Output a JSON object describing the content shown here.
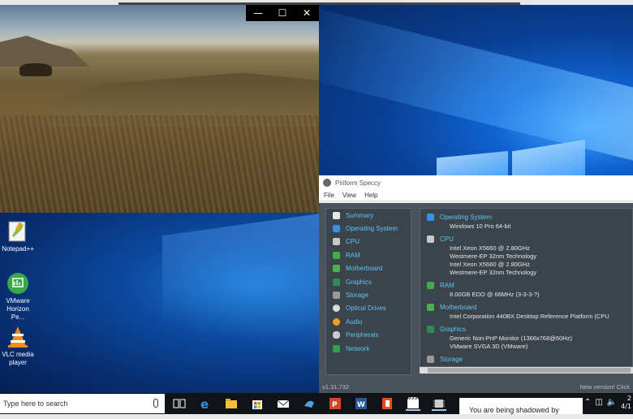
{
  "movie_window": {
    "controls": {
      "minimize": "—",
      "maximize": "☐",
      "close": "✕"
    }
  },
  "desktop_icons": [
    {
      "label": "Notepad++",
      "icon": "notepad-plus-plus-icon"
    },
    {
      "label": "VMware Horizon Pe...",
      "icon": "vmware-horizon-icon"
    },
    {
      "label": "VLC media player",
      "icon": "vlc-icon"
    }
  ],
  "speccy": {
    "title": "Piriform Speccy",
    "menu": [
      "File",
      "View",
      "Help"
    ],
    "nav": [
      {
        "label": "Summary",
        "color": "#e8e8e8"
      },
      {
        "label": "Operating System",
        "color": "#3b8fe0"
      },
      {
        "label": "CPU",
        "color": "#c9c9c9"
      },
      {
        "label": "RAM",
        "color": "#3fae49"
      },
      {
        "label": "Motherboard",
        "color": "#4caf50"
      },
      {
        "label": "Graphics",
        "color": "#2e8b57"
      },
      {
        "label": "Storage",
        "color": "#999999"
      },
      {
        "label": "Optical Drives",
        "color": "#d9d9d9"
      },
      {
        "label": "Audio",
        "color": "#f0a020"
      },
      {
        "label": "Peripherals",
        "color": "#cccccc"
      },
      {
        "label": "Network",
        "color": "#2fa34b"
      }
    ],
    "sections": [
      {
        "title": "Operating System",
        "color": "#3b8fe0",
        "lines": [
          "Windows 10 Pro 64-bit"
        ]
      },
      {
        "title": "CPU",
        "color": "#c9c9c9",
        "lines": [
          "Intel Xeon X5660 @ 2.80GHz",
          "Westmere-EP 32nm Technology",
          "Intel Xeon X5660 @ 2.80GHz",
          "Westmere-EP 32nm Technology"
        ]
      },
      {
        "title": "RAM",
        "color": "#3fae49",
        "lines": [
          "8.00GB EDO @ 66MHz (3-3-3-?)"
        ]
      },
      {
        "title": "Motherboard",
        "color": "#4caf50",
        "lines": [
          "Intel Corporation 440BX Desktop Reference Platform (CPU"
        ]
      },
      {
        "title": "Graphics",
        "color": "#2e8b57",
        "lines": [
          "Generic Non-PnP Monitor (1366x768@60Hz)",
          "VMware SVGA 3D (VMware)"
        ]
      },
      {
        "title": "Storage",
        "color": "#999999",
        "lines": []
      }
    ],
    "version": "v1.31.732",
    "update_text": "New version! Click"
  },
  "taskbar": {
    "search_placeholder": "Type here to search",
    "apps": [
      "task-view-icon",
      "edge-icon",
      "file-explorer-icon",
      "store-icon",
      "mail-icon",
      "vmware-icon",
      "powerpoint-icon",
      "word-icon",
      "office-icon",
      "vlc-taskbar-icon",
      "speccy-taskbar-icon"
    ],
    "toast_text": "You are being shadowed by",
    "clock_line1": "2",
    "clock_line2": "4/1"
  }
}
